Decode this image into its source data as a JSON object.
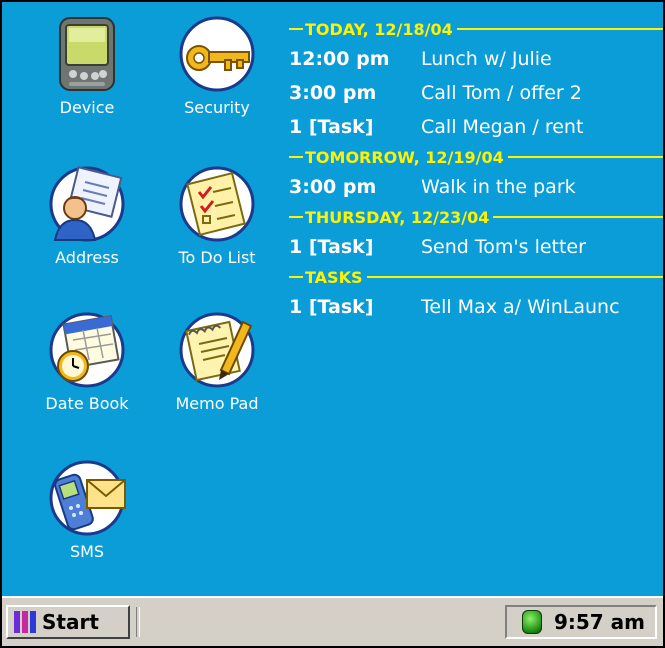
{
  "apps": [
    {
      "label": "Device",
      "icon": "palm-device-icon"
    },
    {
      "label": "Security",
      "icon": "key-icon"
    },
    {
      "label": "Address",
      "icon": "address-card-icon"
    },
    {
      "label": "To Do List",
      "icon": "checklist-icon"
    },
    {
      "label": "Date Book",
      "icon": "calendar-clock-icon"
    },
    {
      "label": "Memo Pad",
      "icon": "memo-pencil-icon"
    },
    {
      "label": "SMS",
      "icon": "phone-envelope-icon"
    }
  ],
  "agenda": {
    "sections": [
      {
        "title": "TODAY, 12/18/04",
        "items": [
          {
            "when": "12:00 pm",
            "what": "Lunch w/ Julie"
          },
          {
            "when": "3:00 pm",
            "what": "Call Tom / offer 2"
          },
          {
            "when": "1 [Task]",
            "what": "Call Megan / rent"
          }
        ]
      },
      {
        "title": "TOMORROW, 12/19/04",
        "items": [
          {
            "when": "3:00 pm",
            "what": "Walk in the park"
          }
        ]
      },
      {
        "title": "THURSDAY, 12/23/04",
        "items": [
          {
            "when": "1 [Task]",
            "what": "Send Tom's letter"
          }
        ]
      },
      {
        "title": "TASKS",
        "items": [
          {
            "when": "1 [Task]",
            "what": "Tell Max a/ WinLaunc"
          }
        ]
      }
    ]
  },
  "taskbar": {
    "start_label": "Start",
    "clock": "9:57 am"
  },
  "colors": {
    "desktop": "#0a9dd8",
    "agenda_header": "#fff200",
    "taskbar": "#d4d0c8"
  }
}
